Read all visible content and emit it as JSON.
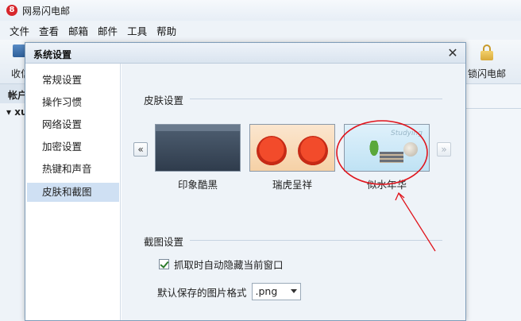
{
  "app": {
    "title": "网易闪电邮",
    "logo_text": "8"
  },
  "menu": [
    "文件",
    "查看",
    "邮箱",
    "邮件",
    "工具",
    "帮助"
  ],
  "toolbar": {
    "left_label": "收信",
    "right_label": "锁闪电邮"
  },
  "account": {
    "strip_label": "帐户",
    "row_label": "▾ xu"
  },
  "dialog": {
    "title": "系统设置",
    "close_glyph": "✕",
    "sidebar": [
      {
        "label": "常规设置"
      },
      {
        "label": "操作习惯"
      },
      {
        "label": "网络设置"
      },
      {
        "label": "加密设置"
      },
      {
        "label": "热键和声音"
      },
      {
        "label": "皮肤和截图",
        "active": true
      }
    ],
    "skin_section": {
      "heading": "皮肤设置",
      "prev_glyph": "«",
      "next_glyph": "»",
      "skins": [
        {
          "name": "印象酷黑",
          "icon": "dark-skin"
        },
        {
          "name": "瑞虎呈祥",
          "icon": "tiger-skin"
        },
        {
          "name": "似水年华",
          "icon": "water-skin",
          "selected": true,
          "script": "Studying"
        }
      ]
    },
    "screenshot_section": {
      "heading": "截图设置",
      "auto_hide_checked": true,
      "auto_hide_label": "抓取时自动隐藏当前窗口",
      "format_label": "默认保存的图片格式",
      "format_value": ".png"
    }
  },
  "colors": {
    "annotation": "#e0141c",
    "active_sidebar": "#cfe0f3",
    "dialog_border": "#7f9db9"
  }
}
